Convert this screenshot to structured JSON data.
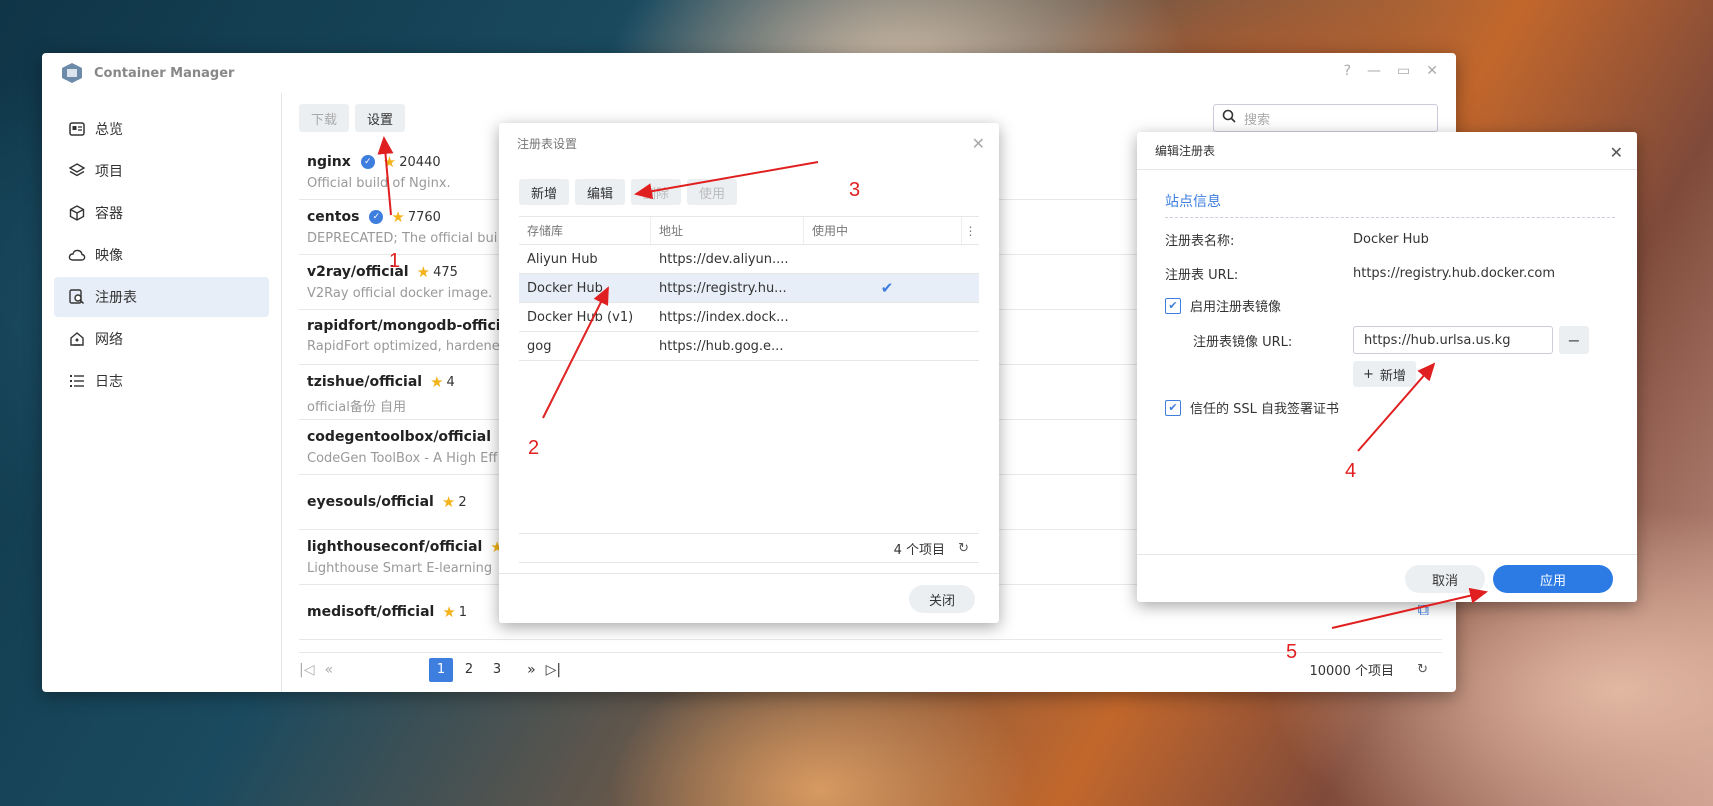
{
  "app": {
    "title": "Container Manager",
    "controls": [
      "?",
      "—",
      "▭",
      "✕"
    ]
  },
  "sidebar": {
    "items": [
      {
        "label": "总览",
        "icon": "overview-icon"
      },
      {
        "label": "项目",
        "icon": "layers-icon"
      },
      {
        "label": "容器",
        "icon": "cube-icon"
      },
      {
        "label": "映像",
        "icon": "cloud-icon"
      },
      {
        "label": "注册表",
        "icon": "registry-search-icon",
        "active": true
      },
      {
        "label": "网络",
        "icon": "network-house-icon"
      },
      {
        "label": "日志",
        "icon": "log-list-icon"
      }
    ]
  },
  "toolbar": {
    "download_label": "下载",
    "settings_label": "设置",
    "search_placeholder": "搜索"
  },
  "repos": [
    {
      "name": "nginx",
      "verified": true,
      "stars": "20440",
      "desc": "Official build of Nginx."
    },
    {
      "name": "centos",
      "verified": true,
      "stars": "7760",
      "desc": "DEPRECATED; The official bui"
    },
    {
      "name": "v2ray/official",
      "verified": false,
      "stars": "475",
      "desc": "V2Ray official docker image."
    },
    {
      "name": "rapidfort/mongodb-officia",
      "verified": false,
      "stars": "",
      "desc": "RapidFort optimized, hardene"
    },
    {
      "name": "tzishue/official",
      "verified": false,
      "stars": "4",
      "desc": "official备份 自用"
    },
    {
      "name": "codegentoolbox/official",
      "verified": false,
      "stars": "",
      "desc": "CodeGen ToolBox - A High Eff"
    },
    {
      "name": "eyesouls/official",
      "verified": false,
      "stars": "2",
      "desc": ""
    },
    {
      "name": "lighthouseconf/official",
      "verified": false,
      "stars": "",
      "desc": "Lighthouse Smart E-learning"
    },
    {
      "name": "medisoft/official",
      "verified": false,
      "stars": "1",
      "desc": ""
    }
  ],
  "pager": {
    "pages": [
      "1",
      "2",
      "3"
    ],
    "current": "1",
    "total": "10000 个项目"
  },
  "registry_dialog": {
    "title": "注册表设置",
    "buttons": {
      "add": "新增",
      "edit": "编辑",
      "delete": "删除",
      "use": "使用"
    },
    "columns": [
      "存储库",
      "地址",
      "使用中"
    ],
    "rows": [
      {
        "name": "Aliyun Hub",
        "url": "https://dev.aliyun....",
        "in_use": ""
      },
      {
        "name": "Docker Hub",
        "url": "https://registry.hu...",
        "in_use": "✔"
      },
      {
        "name": "Docker Hub (v1)",
        "url": "https://index.dock...",
        "in_use": ""
      },
      {
        "name": "gog",
        "url": "https://hub.gog.e...",
        "in_use": ""
      }
    ],
    "count": "4 个项目",
    "close_label": "关闭"
  },
  "edit_dialog": {
    "title": "编辑注册表",
    "section": "站点信息",
    "name_label": "注册表名称:",
    "name_value": "Docker Hub",
    "url_label": "注册表 URL:",
    "url_value": "https://registry.hub.docker.com",
    "mirror_checkbox": "启用注册表镜像",
    "mirror_url_label": "注册表镜像 URL:",
    "mirror_url_value": "https://hub.urlsa.us.kg",
    "add_label": "新增",
    "ssl_checkbox": "信任的 SSL 自我签署证书",
    "cancel_label": "取消",
    "apply_label": "应用"
  },
  "annotations": [
    "1",
    "2",
    "3",
    "4",
    "5"
  ],
  "colors": {
    "accent": "#3d7ede",
    "annotation": "#e02020"
  }
}
